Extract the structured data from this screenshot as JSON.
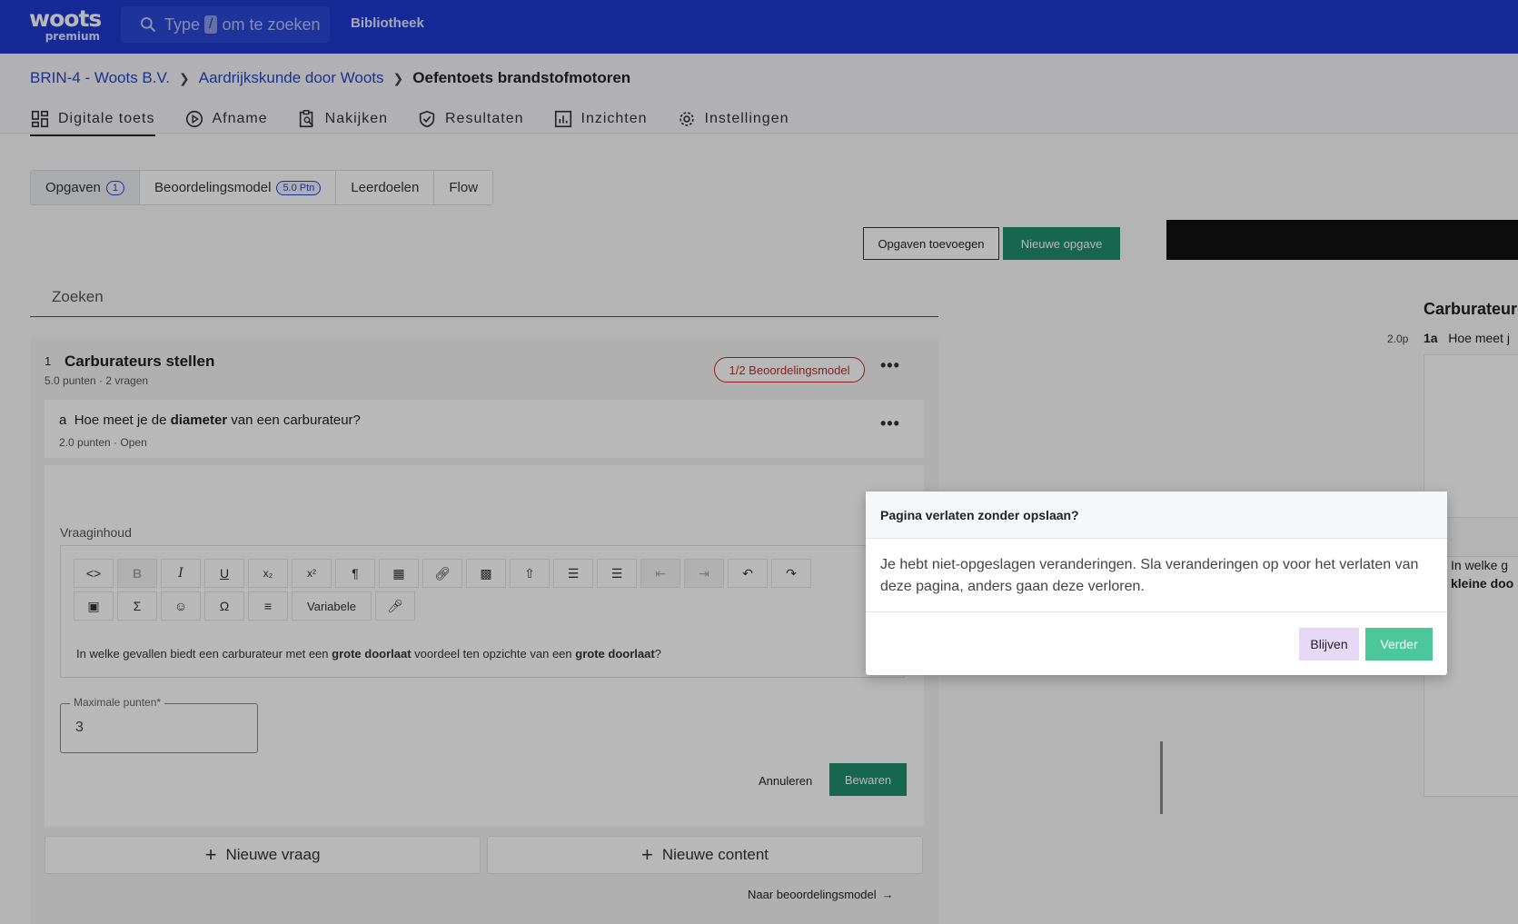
{
  "topbar": {
    "logo_word": "woots",
    "logo_tier": "premium",
    "search_prefix": "Type",
    "search_key": "/",
    "search_suffix": "om te zoeken",
    "library": "Bibliotheek"
  },
  "breadcrumb": {
    "items": [
      "BRIN-4 - Woots B.V.",
      "Aardrijkskunde door Woots"
    ],
    "current": "Oefentoets brandstofmotoren"
  },
  "nav": {
    "tabs": [
      "Digitale toets",
      "Afname",
      "Nakijken",
      "Resultaten",
      "Inzichten",
      "Instellingen"
    ]
  },
  "subtabs": {
    "items": [
      "Opgaven",
      "Beoordelingsmodel",
      "Leerdoelen",
      "Flow"
    ],
    "opgaven_count": "1",
    "beoordeling_badge": "5.0 Ptn"
  },
  "actions": {
    "add_questions": "Opgaven toevoegen",
    "new_question": "Nieuwe opgave"
  },
  "search_placeholder": "Zoeken",
  "question": {
    "number": "1",
    "title": "Carburateurs stellen",
    "meta": "5.0 punten · 2 vragen",
    "model_status": "1/2 Beoordelingsmodel",
    "sub_letter": "a",
    "sub_pre": "Hoe meet je de",
    "sub_bold": "diameter",
    "sub_post": "van een carburateur?",
    "sub_meta": "2.0 punten · Open",
    "content_label": "Vraaginhoud",
    "content_pre": "In welke gevallen biedt een carburateur met een",
    "content_bold1": "grote doorlaat",
    "content_mid": "voordeel ten opzichte van een",
    "content_bold2": "grote doorlaat",
    "content_end": "?",
    "variable_label": "Variabele",
    "max_points_label": "Maximale punten*",
    "max_points_value": "3",
    "cancel": "Annuleren",
    "save": "Bewaren",
    "new_question": "Nieuwe vraag",
    "new_content": "Nieuwe content",
    "to_model": "Naar beoordelingsmodel"
  },
  "preview": {
    "title": "Carburateur",
    "points": "2.0p",
    "q_label": "1a",
    "q_text": "Hoe meet j",
    "body_line1": "In welke g",
    "body_line2": "kleine doo"
  },
  "dialog": {
    "title": "Pagina verlaten zonder opslaan?",
    "body": "Je hebt niet-opgeslagen veranderingen. Sla veranderingen op voor het verlaten van deze pagina, anders gaan deze verloren.",
    "stay": "Blijven",
    "continue": "Verder"
  },
  "colors": {
    "topbar": "#1e3bd0",
    "primary_green": "#1f8f6b",
    "dialog_continue": "#4cc79c",
    "dialog_stay": "#e6d8f7",
    "error_red": "#c62828",
    "link_blue": "#2546c8"
  },
  "icons": [
    "search-icon",
    "grid-icon",
    "play-circle-icon",
    "clipboard-search-icon",
    "shield-check-icon",
    "bar-chart-icon",
    "gear-icon",
    "more-dots-icon",
    "plus-icon",
    "arrow-right-icon"
  ]
}
